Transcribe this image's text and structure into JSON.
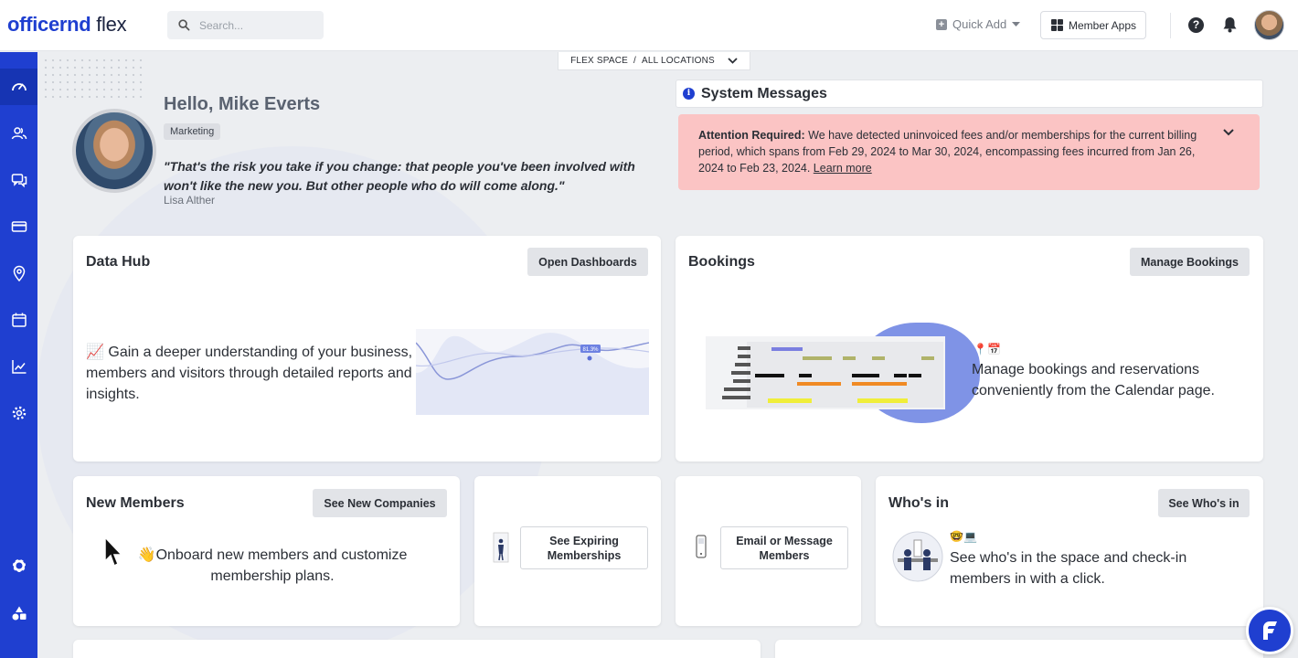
{
  "header": {
    "logo_main": "officernd",
    "logo_suffix": " flex",
    "search_placeholder": "Search...",
    "quick_add": "Quick Add",
    "member_apps": "Member Apps",
    "help": "?"
  },
  "location": {
    "space": "FLEX SPACE",
    "separator": "/",
    "scope": "ALL LOCATIONS"
  },
  "greeting": {
    "hello": "Hello, Mike Everts",
    "department": "Marketing",
    "quote": "\"That's the risk you take if you change: that people you've been involved with won't like the new you. But other people who do will come along.\"",
    "author": "Lisa Alther"
  },
  "system_messages": {
    "title": "System Messages",
    "alert_label": "Attention Required:",
    "alert_text": " We have detected uninvoiced fees and/or memberships for the current billing period, which spans from Feb 29, 2024 to Mar 30, 2024, encompassing fees incurred from Jan 26, 2024 to Feb 23, 2024. ",
    "alert_link": "Learn more"
  },
  "cards": {
    "data_hub": {
      "title": "Data Hub",
      "button": "Open Dashboards",
      "emoji": "📈",
      "text": " Gain a deeper understanding of your business, members and visitors through detailed reports and insights.",
      "chart_badge": "81.3%"
    },
    "bookings": {
      "title": "Bookings",
      "button": "Manage Bookings",
      "emoji": "📍📅",
      "text": "Manage bookings and reservations conveniently from the Calendar page."
    },
    "new_members": {
      "title": "New Members",
      "button": "See New Companies",
      "emoji": "👋",
      "text": "Onboard new members and customize membership plans."
    },
    "expiring": {
      "button": "See Expiring Memberships"
    },
    "message": {
      "button": "Email or Message Members"
    },
    "whos_in": {
      "title": "Who's in",
      "button": "See Who's in",
      "emoji": "🤓💻",
      "text": "See who's in the space and check-in members in with a click."
    }
  },
  "colors": {
    "brand": "#1f3fd0",
    "alert_bg": "#fbc4c4",
    "page_bg": "#eceef1"
  }
}
